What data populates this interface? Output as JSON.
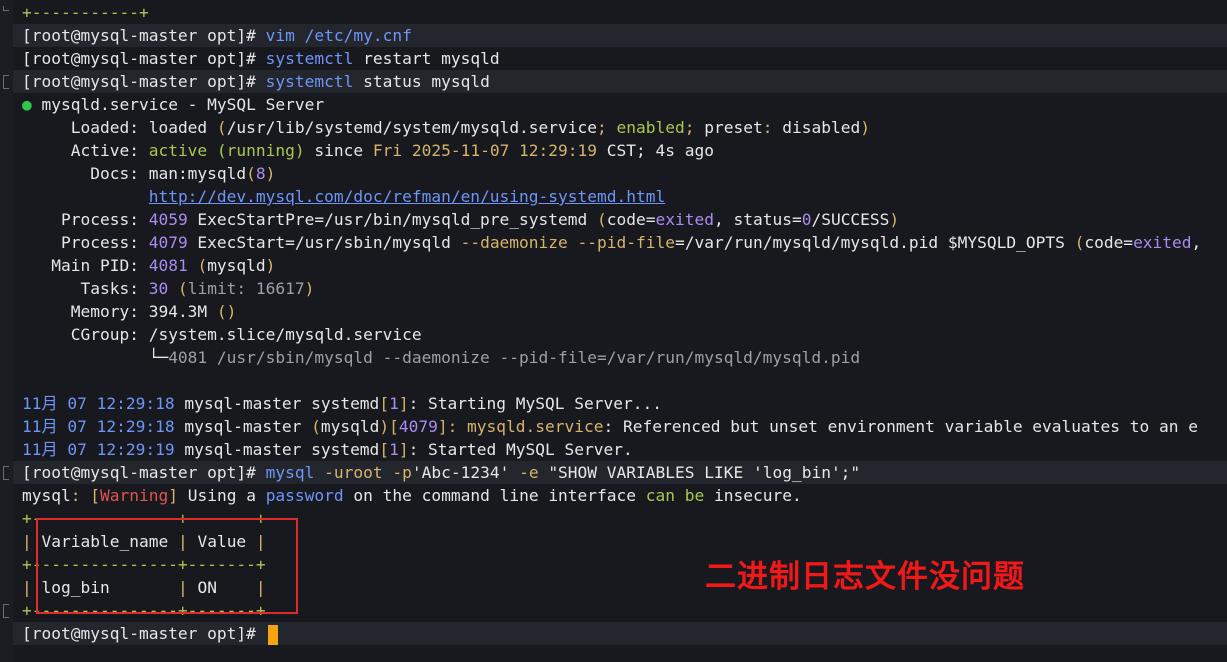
{
  "terminal": {
    "lines": [
      {
        "band": false,
        "segments": [
          {
            "t": "+-----------+",
            "c": "c-green"
          }
        ]
      },
      {
        "band": true,
        "segments": [
          {
            "t": "[root@mysql-master opt]# ",
            "c": "c-white"
          },
          {
            "t": "vim",
            "c": "c-blue"
          },
          {
            "t": " /etc/my.cnf",
            "c": "c-blue"
          }
        ]
      },
      {
        "band": false,
        "segments": [
          {
            "t": "[root@mysql-master opt]# ",
            "c": "c-white"
          },
          {
            "t": "systemctl",
            "c": "c-blue"
          },
          {
            "t": " restart mysqld",
            "c": "c-white"
          }
        ]
      },
      {
        "band": true,
        "segments": [
          {
            "t": "[root@mysql-master opt]# ",
            "c": "c-white"
          },
          {
            "t": "systemctl",
            "c": "c-blue"
          },
          {
            "t": " status mysqld",
            "c": "c-white"
          }
        ]
      },
      {
        "band": false,
        "segments": [
          {
            "t": "●",
            "c": "c-ok"
          },
          {
            "t": " mysqld.service - MySQL Server",
            "c": "c-white"
          }
        ]
      },
      {
        "band": false,
        "segments": [
          {
            "t": "     Loaded: ",
            "c": "c-white"
          },
          {
            "t": "loaded",
            "c": "c-white"
          },
          {
            "t": " (",
            "c": "c-yellow"
          },
          {
            "t": "/usr/lib/systemd/system/mysqld.service",
            "c": "c-white"
          },
          {
            "t": "; ",
            "c": "c-yellow"
          },
          {
            "t": "enabled",
            "c": "c-green"
          },
          {
            "t": "; ",
            "c": "c-yellow"
          },
          {
            "t": "preset",
            "c": "c-white"
          },
          {
            "t": ": ",
            "c": "c-yellow"
          },
          {
            "t": "disabled",
            "c": "c-white"
          },
          {
            "t": ")",
            "c": "c-yellow"
          }
        ]
      },
      {
        "band": false,
        "segments": [
          {
            "t": "     Active: ",
            "c": "c-white"
          },
          {
            "t": "active (running)",
            "c": "c-green"
          },
          {
            "t": " since ",
            "c": "c-white"
          },
          {
            "t": "Fri 2025-11-07 12:29:19",
            "c": "c-yellow"
          },
          {
            "t": " CST; 4s ago",
            "c": "c-white"
          }
        ]
      },
      {
        "band": false,
        "segments": [
          {
            "t": "       Docs: ",
            "c": "c-white"
          },
          {
            "t": "man:mysqld",
            "c": "c-white"
          },
          {
            "t": "(",
            "c": "c-yellow"
          },
          {
            "t": "8",
            "c": "c-purple"
          },
          {
            "t": ")",
            "c": "c-yellow"
          }
        ]
      },
      {
        "band": false,
        "segments": [
          {
            "t": "             ",
            "c": "c-white"
          },
          {
            "t": "http://dev.mysql.com/doc/refman/en/using-systemd.html",
            "c": "c-link"
          }
        ]
      },
      {
        "band": false,
        "segments": [
          {
            "t": "    Process: ",
            "c": "c-white"
          },
          {
            "t": "4059",
            "c": "c-purple"
          },
          {
            "t": " ExecStartPre=/usr/bin/mysqld_pre_systemd ",
            "c": "c-white"
          },
          {
            "t": "(",
            "c": "c-yellow"
          },
          {
            "t": "code=",
            "c": "c-white"
          },
          {
            "t": "exited",
            "c": "c-purple"
          },
          {
            "t": ", status=",
            "c": "c-white"
          },
          {
            "t": "0",
            "c": "c-purple"
          },
          {
            "t": "/SUCCESS",
            "c": "c-white"
          },
          {
            "t": ")",
            "c": "c-yellow"
          }
        ]
      },
      {
        "band": false,
        "segments": [
          {
            "t": "    Process: ",
            "c": "c-white"
          },
          {
            "t": "4079",
            "c": "c-purple"
          },
          {
            "t": " ExecStart=/usr/sbin/mysqld ",
            "c": "c-white"
          },
          {
            "t": "--daemonize",
            "c": "c-yellow"
          },
          {
            "t": " ",
            "c": "c-white"
          },
          {
            "t": "--pid-file",
            "c": "c-yellow"
          },
          {
            "t": "=/var/run/mysqld/mysqld.pid $MYSQLD_OPTS ",
            "c": "c-white"
          },
          {
            "t": "(",
            "c": "c-yellow"
          },
          {
            "t": "code=",
            "c": "c-white"
          },
          {
            "t": "exited",
            "c": "c-purple"
          },
          {
            "t": ",",
            "c": "c-white"
          }
        ]
      },
      {
        "band": false,
        "segments": [
          {
            "t": "   Main PID: ",
            "c": "c-white"
          },
          {
            "t": "4081",
            "c": "c-purple"
          },
          {
            "t": " ",
            "c": "c-white"
          },
          {
            "t": "(",
            "c": "c-yellow"
          },
          {
            "t": "mysqld",
            "c": "c-white"
          },
          {
            "t": ")",
            "c": "c-yellow"
          }
        ]
      },
      {
        "band": false,
        "segments": [
          {
            "t": "      Tasks: ",
            "c": "c-white"
          },
          {
            "t": "30",
            "c": "c-purple"
          },
          {
            "t": " ",
            "c": "c-white"
          },
          {
            "t": "(",
            "c": "c-yellow"
          },
          {
            "t": "limit: 16617",
            "c": "c-gray"
          },
          {
            "t": ")",
            "c": "c-yellow"
          }
        ]
      },
      {
        "band": false,
        "segments": [
          {
            "t": "     Memory: ",
            "c": "c-white"
          },
          {
            "t": "394.3M",
            "c": "c-white"
          },
          {
            "t": " ()",
            "c": "c-yellow"
          }
        ]
      },
      {
        "band": false,
        "segments": [
          {
            "t": "     CGroup: ",
            "c": "c-white"
          },
          {
            "t": "/system.slice/mysqld.service",
            "c": "c-white"
          }
        ]
      },
      {
        "band": false,
        "segments": [
          {
            "t": "             └─",
            "c": "c-white"
          },
          {
            "t": "4081 /usr/sbin/mysqld --daemonize --pid-file=/var/run/mysqld/mysqld.pid",
            "c": "c-gray"
          }
        ]
      },
      {
        "band": false,
        "segments": [
          {
            "t": "",
            "c": "c-white"
          }
        ]
      },
      {
        "band": false,
        "segments": [
          {
            "t": "11月 07 12:29:18",
            "c": "c-blue"
          },
          {
            "t": " mysql-master systemd",
            "c": "c-white"
          },
          {
            "t": "[",
            "c": "c-yellow"
          },
          {
            "t": "1",
            "c": "c-purple"
          },
          {
            "t": "]",
            "c": "c-yellow"
          },
          {
            "t": ": Starting MySQL Server...",
            "c": "c-white"
          }
        ]
      },
      {
        "band": false,
        "segments": [
          {
            "t": "11月 07 12:29:18",
            "c": "c-blue"
          },
          {
            "t": " mysql-master ",
            "c": "c-white"
          },
          {
            "t": "(",
            "c": "c-yellow"
          },
          {
            "t": "mysqld",
            "c": "c-white"
          },
          {
            "t": ")",
            "c": "c-yellow"
          },
          {
            "t": "[",
            "c": "c-yellow"
          },
          {
            "t": "4079",
            "c": "c-purple"
          },
          {
            "t": "]",
            "c": "c-yellow"
          },
          {
            "t": ": mysqld.service",
            "c": "c-yellow"
          },
          {
            "t": ": Referenced but unset environment variable evaluates to an e",
            "c": "c-white"
          }
        ]
      },
      {
        "band": false,
        "segments": [
          {
            "t": "11月 07 12:29:19",
            "c": "c-blue"
          },
          {
            "t": " mysql-master systemd",
            "c": "c-white"
          },
          {
            "t": "[",
            "c": "c-yellow"
          },
          {
            "t": "1",
            "c": "c-purple"
          },
          {
            "t": "]",
            "c": "c-yellow"
          },
          {
            "t": ": Started MySQL Server.",
            "c": "c-white"
          }
        ]
      },
      {
        "band": true,
        "segments": [
          {
            "t": "[root@mysql-master opt]# ",
            "c": "c-white"
          },
          {
            "t": "mysql",
            "c": "c-blue"
          },
          {
            "t": " -uroot -p",
            "c": "c-yellow"
          },
          {
            "t": "'Abc-1234'",
            "c": "c-white"
          },
          {
            "t": " -e ",
            "c": "c-yellow"
          },
          {
            "t": "\"SHOW VARIABLES LIKE 'log_bin';\"",
            "c": "c-white"
          }
        ]
      },
      {
        "band": false,
        "segments": [
          {
            "t": "mysql",
            "c": "c-white"
          },
          {
            "t": ": ",
            "c": "c-yellow"
          },
          {
            "t": "[",
            "c": "c-yellow"
          },
          {
            "t": "Warning",
            "c": "c-red"
          },
          {
            "t": "]",
            "c": "c-yellow"
          },
          {
            "t": " Using a ",
            "c": "c-white"
          },
          {
            "t": "password",
            "c": "c-blue"
          },
          {
            "t": " on the command line interface ",
            "c": "c-white"
          },
          {
            "t": "can be",
            "c": "c-green"
          },
          {
            "t": " insecure.",
            "c": "c-white"
          }
        ]
      },
      {
        "band": false,
        "segments": [
          {
            "t": "+---------------+-------+",
            "c": "c-green"
          }
        ]
      },
      {
        "band": false,
        "segments": [
          {
            "t": "| ",
            "c": "c-yellow"
          },
          {
            "t": "Variable_name",
            "c": "c-white"
          },
          {
            "t": " | ",
            "c": "c-yellow"
          },
          {
            "t": "Value",
            "c": "c-white"
          },
          {
            "t": " |",
            "c": "c-yellow"
          }
        ]
      },
      {
        "band": false,
        "segments": [
          {
            "t": "+---------------+-------+",
            "c": "c-green"
          }
        ]
      },
      {
        "band": false,
        "segments": [
          {
            "t": "| ",
            "c": "c-yellow"
          },
          {
            "t": "log_bin",
            "c": "c-white"
          },
          {
            "t": "       | ",
            "c": "c-yellow"
          },
          {
            "t": "ON",
            "c": "c-white"
          },
          {
            "t": "    |",
            "c": "c-yellow"
          }
        ]
      },
      {
        "band": false,
        "segments": [
          {
            "t": "+---------------+-------+",
            "c": "c-green"
          }
        ]
      },
      {
        "band": true,
        "segments": [
          {
            "t": "[root@mysql-master opt]# ",
            "c": "c-white"
          }
        ],
        "cursor": true
      }
    ]
  },
  "annotation": {
    "text": "二进制日志文件没问题",
    "color": "#f01818"
  },
  "colors": {
    "background": "#17191e",
    "prompt_band": "#23262d",
    "cursor": "#f4a40e",
    "highlight": "#e02b2b"
  }
}
